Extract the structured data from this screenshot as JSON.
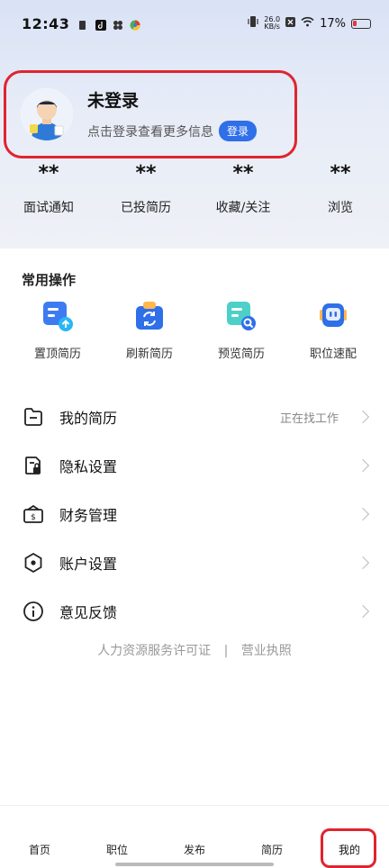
{
  "status_bar": {
    "time": "12:43",
    "speed": "26.0\nKB/s",
    "battery": "17%"
  },
  "profile": {
    "title": "未登录",
    "subtitle": "点击登录查看更多信息",
    "login_label": "登录"
  },
  "stats": [
    {
      "value": "**",
      "label": "面试通知"
    },
    {
      "value": "**",
      "label": "已投简历"
    },
    {
      "value": "**",
      "label": "收藏/关注"
    },
    {
      "value": "**",
      "label": "浏览"
    }
  ],
  "quick_actions": {
    "title": "常用操作",
    "items": [
      {
        "label": "置顶简历",
        "icon": "pin-resume-icon"
      },
      {
        "label": "刷新简历",
        "icon": "refresh-resume-icon"
      },
      {
        "label": "预览简历",
        "icon": "preview-resume-icon"
      },
      {
        "label": "职位速配",
        "icon": "job-match-icon"
      }
    ]
  },
  "menu": [
    {
      "label": "我的简历",
      "right": "正在找工作",
      "icon": "resume-folder-icon"
    },
    {
      "label": "隐私设置",
      "right": "",
      "icon": "privacy-lock-icon"
    },
    {
      "label": "财务管理",
      "right": "",
      "icon": "wallet-icon"
    },
    {
      "label": "账户设置",
      "right": "",
      "icon": "settings-hexagon-icon"
    },
    {
      "label": "意见反馈",
      "right": "",
      "icon": "info-icon"
    }
  ],
  "footer": {
    "license": "人力资源服务许可证",
    "separator": "|",
    "business": "营业执照"
  },
  "tabbar": [
    {
      "label": "首页"
    },
    {
      "label": "职位"
    },
    {
      "label": "发布"
    },
    {
      "label": "简历"
    },
    {
      "label": "我的"
    }
  ],
  "colors": {
    "accent": "#2f6fe8",
    "highlight": "#e0242e"
  }
}
